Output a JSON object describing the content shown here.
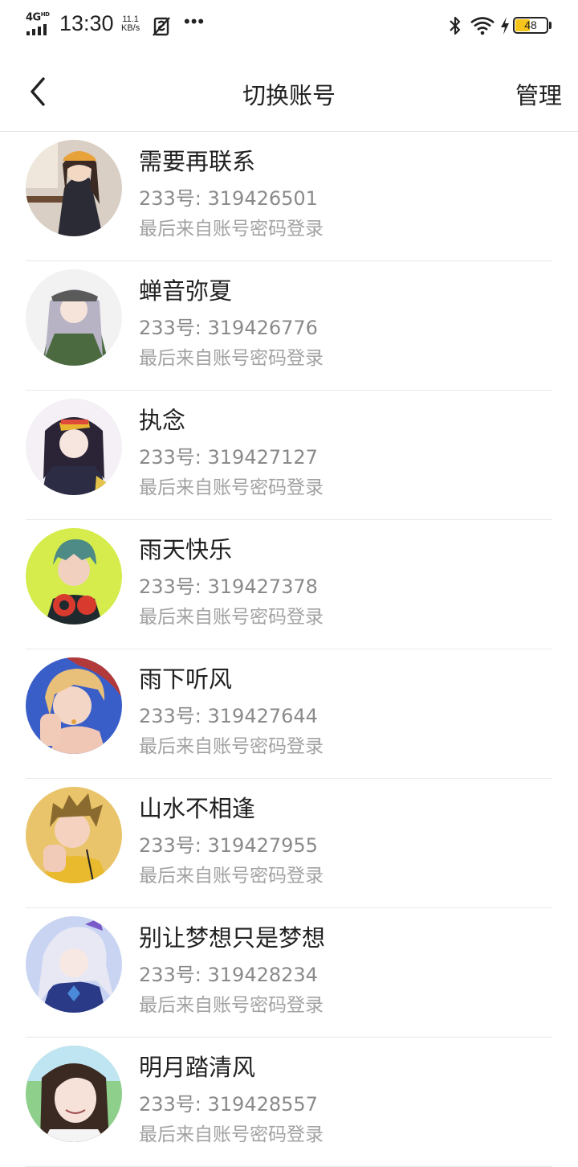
{
  "status_bar": {
    "network": "4G",
    "network_sup": "HD",
    "time": "13:30",
    "speed_value": "11.1",
    "speed_unit": "KB/s",
    "more": "•••",
    "battery_level": "48",
    "battery_fraction": 0.48,
    "battery_color": "#f5c51b"
  },
  "header": {
    "title": "切换账号",
    "manage_label": "管理",
    "back_icon": "chevron-left-icon"
  },
  "accounts": [
    {
      "name": "需要再联系",
      "uid": "233号: 319426501",
      "last_login": "最后来自账号密码登录",
      "avatar_bg": "#d9cfc4"
    },
    {
      "name": "蝉音弥夏",
      "uid": "233号: 319426776",
      "last_login": "最后来自账号密码登录",
      "avatar_bg": "#f2f2f2"
    },
    {
      "name": "执念",
      "uid": "233号: 319427127",
      "last_login": "最后来自账号密码登录",
      "avatar_bg": "#f4f0f6"
    },
    {
      "name": "雨天快乐",
      "uid": "233号: 319427378",
      "last_login": "最后来自账号密码登录",
      "avatar_bg": "#d5ec4c"
    },
    {
      "name": "雨下听风",
      "uid": "233号: 319427644",
      "last_login": "最后来自账号密码登录",
      "avatar_bg": "#3a5ec8"
    },
    {
      "name": "山水不相逢",
      "uid": "233号: 319427955",
      "last_login": "最后来自账号密码登录",
      "avatar_bg": "#e9c46a"
    },
    {
      "name": "别让梦想只是梦想",
      "uid": "233号: 319428234",
      "last_login": "最后来自账号密码登录",
      "avatar_bg": "#c9d4f2"
    },
    {
      "name": "明月踏清风",
      "uid": "233号: 319428557",
      "last_login": "最后来自账号密码登录",
      "avatar_bg": "#8fcf8c"
    }
  ]
}
